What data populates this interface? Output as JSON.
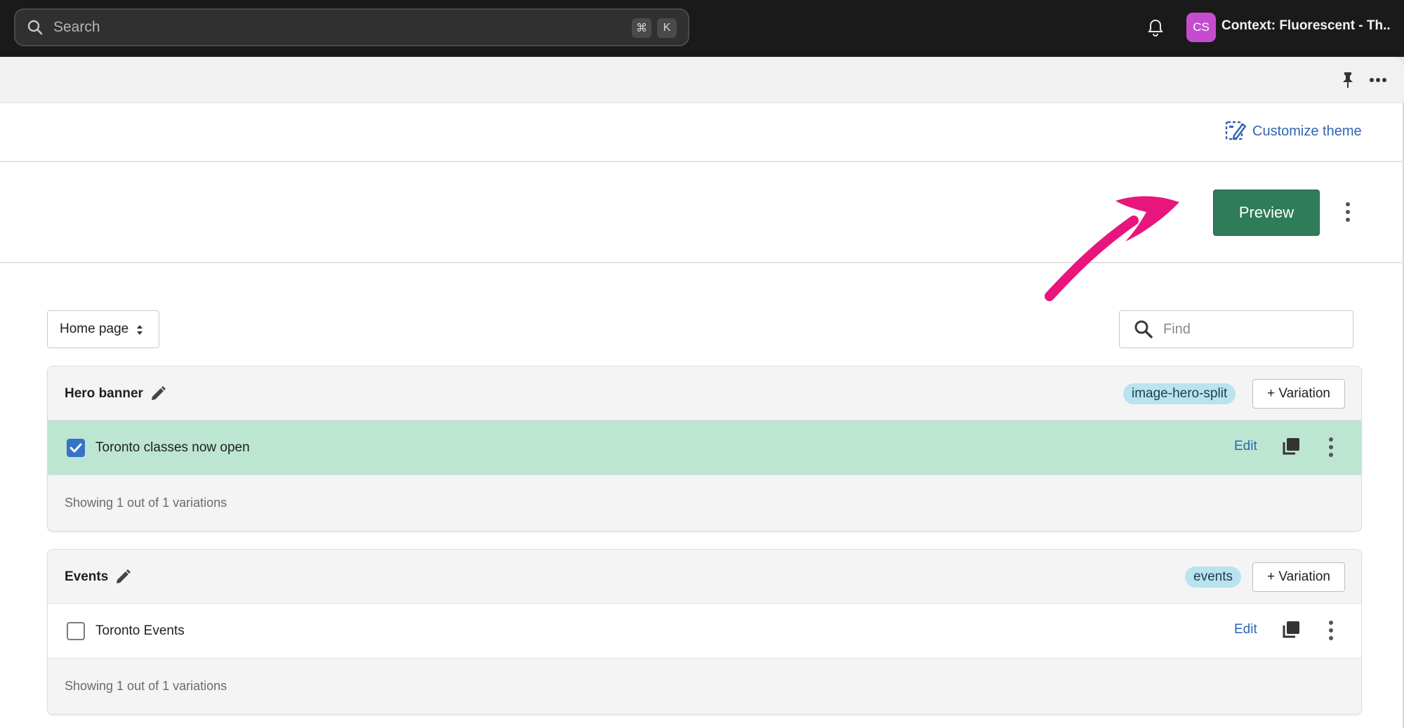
{
  "topbar": {
    "search": {
      "placeholder": "Search",
      "shortcut_cmd": "⌘",
      "shortcut_key": "K"
    },
    "avatar_initials": "CS",
    "context_label": "Context: Fluorescent - Th..."
  },
  "theme": {
    "customize_label": "Customize theme"
  },
  "actions": {
    "preview_label": "Preview"
  },
  "filters": {
    "page_select_value": "Home page",
    "find_placeholder": "Find"
  },
  "sections": [
    {
      "title": "Hero banner",
      "tag": "image-hero-split",
      "add_variation_label": "+ Variation",
      "rows": [
        {
          "label": "Toronto classes now open",
          "checked": true,
          "edit_label": "Edit"
        }
      ],
      "footer": "Showing 1 out of 1 variations"
    },
    {
      "title": "Events",
      "tag": "events",
      "add_variation_label": "+ Variation",
      "rows": [
        {
          "label": "Toronto Events",
          "checked": false,
          "edit_label": "Edit"
        }
      ],
      "footer": "Showing 1 out of 1 variations"
    }
  ],
  "colors": {
    "topbar_bg": "#1a1a1a",
    "avatar_bg": "#c54ccf",
    "link": "#2f64b5",
    "primary_button": "#2e7c59",
    "selected_row": "#bce6d2",
    "tag_bg": "#b9e3ef",
    "checkbox_checked": "#3572c9",
    "annotation_arrow": "#e8157d"
  },
  "icons": [
    "search-icon",
    "bell-icon",
    "pin-icon",
    "more-horizontal-icon",
    "customize-theme-icon",
    "more-vertical-icon",
    "sort-chevrons-icon",
    "pencil-icon",
    "duplicate-icon",
    "check-icon",
    "annotation-arrow"
  ]
}
